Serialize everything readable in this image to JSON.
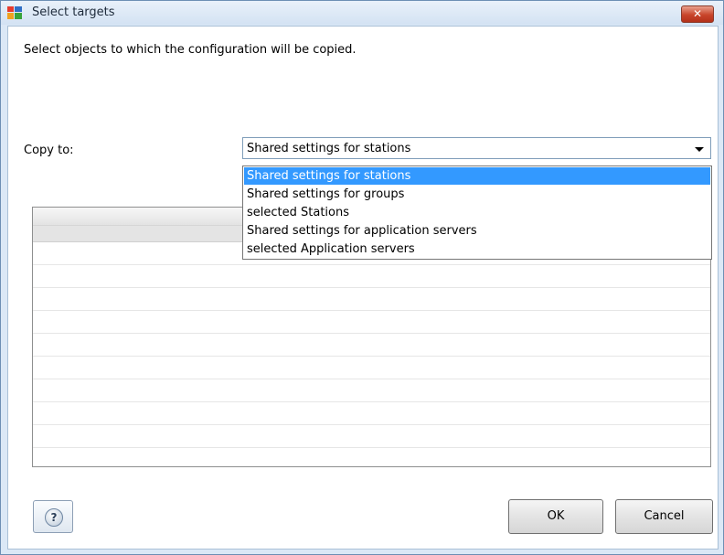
{
  "window": {
    "title": "Select targets",
    "close_symbol": "✕",
    "icon": "avg-logo-icon"
  },
  "dialog": {
    "instructions": "Select objects to which the configuration will be copied.",
    "copy_to_label": "Copy to:",
    "copy_to_selected": "Shared settings for stations",
    "copy_to_options": [
      "Shared settings for stations",
      "Shared settings for groups",
      "selected Stations",
      "Shared settings for application servers",
      "selected Application servers"
    ],
    "selected_option_index": 0
  },
  "buttons": {
    "help_symbol": "?",
    "ok": "OK",
    "cancel": "Cancel"
  },
  "colors": {
    "selection": "#3399ff",
    "close_button": "#c8452a",
    "title_bar": "#dbe8f6"
  }
}
